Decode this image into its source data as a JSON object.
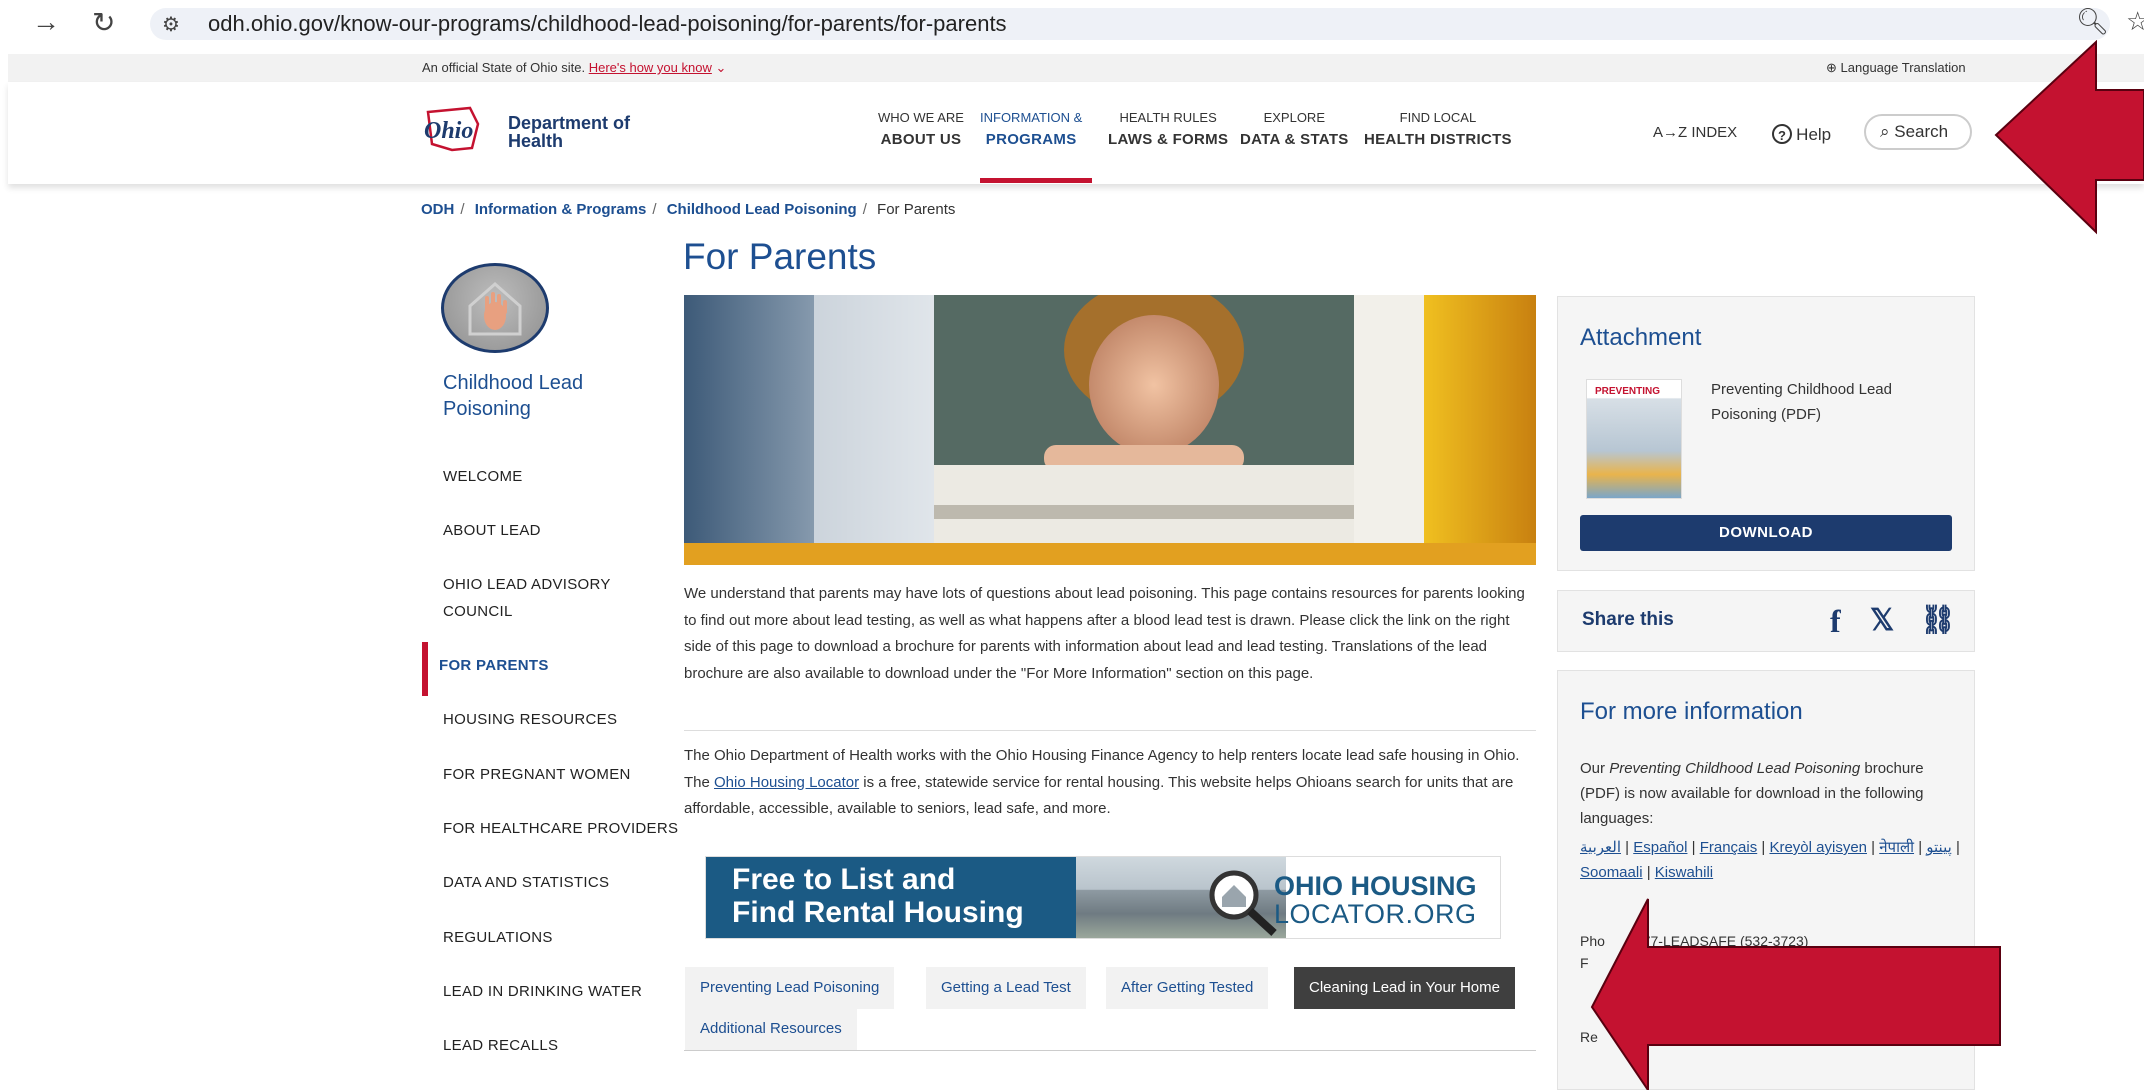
{
  "browser": {
    "url": "odh.ohio.gov/know-our-programs/childhood-lead-poisoning/for-parents/for-parents",
    "back_icon": "arrow-right-icon",
    "reload_icon": "reload-icon",
    "zoom_icon": "zoom-icon",
    "star_icon": "star-icon"
  },
  "official_banner": {
    "text": "An official State of Ohio site.",
    "link": "Here's how you know",
    "language": "Language Translation"
  },
  "header": {
    "logo_word": "Ohio",
    "org_line1": "Department of",
    "org_line2": "Health",
    "nav": [
      {
        "top": "WHO WE ARE",
        "bottom": "ABOUT US"
      },
      {
        "top": "INFORMATION &",
        "bottom": "PROGRAMS"
      },
      {
        "top": "HEALTH RULES",
        "bottom": "LAWS & FORMS"
      },
      {
        "top": "EXPLORE",
        "bottom": "DATA & STATS"
      },
      {
        "top": "FIND LOCAL",
        "bottom": "HEALTH DISTRICTS"
      }
    ],
    "index_label": "A→Z  INDEX",
    "help_label": "Help",
    "search_label": "Search"
  },
  "breadcrumb": {
    "items": [
      "ODH",
      "Information & Programs",
      "Childhood Lead Poisoning"
    ],
    "current": "For Parents"
  },
  "sidebar": {
    "title": "Childhood Lead Poisoning",
    "items": [
      "WELCOME",
      "ABOUT LEAD",
      "OHIO LEAD ADVISORY COUNCIL",
      "FOR PARENTS",
      "HOUSING RESOURCES",
      "FOR PREGNANT WOMEN",
      "FOR HEALTHCARE PROVIDERS",
      "DATA AND STATISTICS",
      "REGULATIONS",
      "LEAD IN DRINKING WATER",
      "LEAD RECALLS"
    ]
  },
  "main": {
    "title": "For Parents",
    "para1": "We understand that parents may have lots of questions about lead poisoning. This page contains resources for parents looking to find out more about lead testing, as well as what happens after a blood lead test is drawn. Please click the link on the right side of this page to download a brochure for parents with information about lead and lead testing. Translations of the lead brochure are also available to download under the \"For More Information\" section on this page.",
    "para2_a": "The Ohio Department of Health works with the Ohio Housing Finance Agency to help renters locate lead safe housing in Ohio. The ",
    "para2_link": "Ohio Housing Locator",
    "para2_b": " is a free, statewide service for rental housing. This website helps Ohioans search for units that are affordable, accessible, available to seniors, lead safe, and more.",
    "banner": {
      "line1": "Free to List and",
      "line2": "Find Rental Housing",
      "brand1": "OHIO HOUSING",
      "brand2": "LOCATOR.ORG"
    },
    "tabs": [
      "Preventing Lead Poisoning",
      "Getting a Lead Test",
      "After Getting Tested",
      "Cleaning Lead in Your Home",
      "Additional Resources"
    ]
  },
  "right": {
    "attachment_title": "Attachment",
    "thumb_text": "PREVENTING",
    "attachment_name": "Preventing Childhood Lead Poisoning (PDF)",
    "download_label": "DOWNLOAD",
    "share_label": "Share this",
    "share_icons": [
      "facebook-icon",
      "x-icon",
      "link-icon"
    ],
    "more_title": "For more information",
    "more_pre": "Our ",
    "more_em": "Preventing Childhood Lead Poisoning",
    "more_post": " brochure (PDF) is now available for download in the following languages:",
    "languages": [
      "العربية",
      "Español",
      "Français",
      "Kreyòl ayisyen",
      "नेपाली",
      "پینتو",
      "Soomaali",
      "Kiswahili"
    ],
    "phone_partial": "Pho",
    "phone_rest": "877-LEADSAFE (532-3723)",
    "partial_letters": [
      "F",
      "Re"
    ]
  },
  "annotations": {
    "arrow_color": "#c41230"
  }
}
